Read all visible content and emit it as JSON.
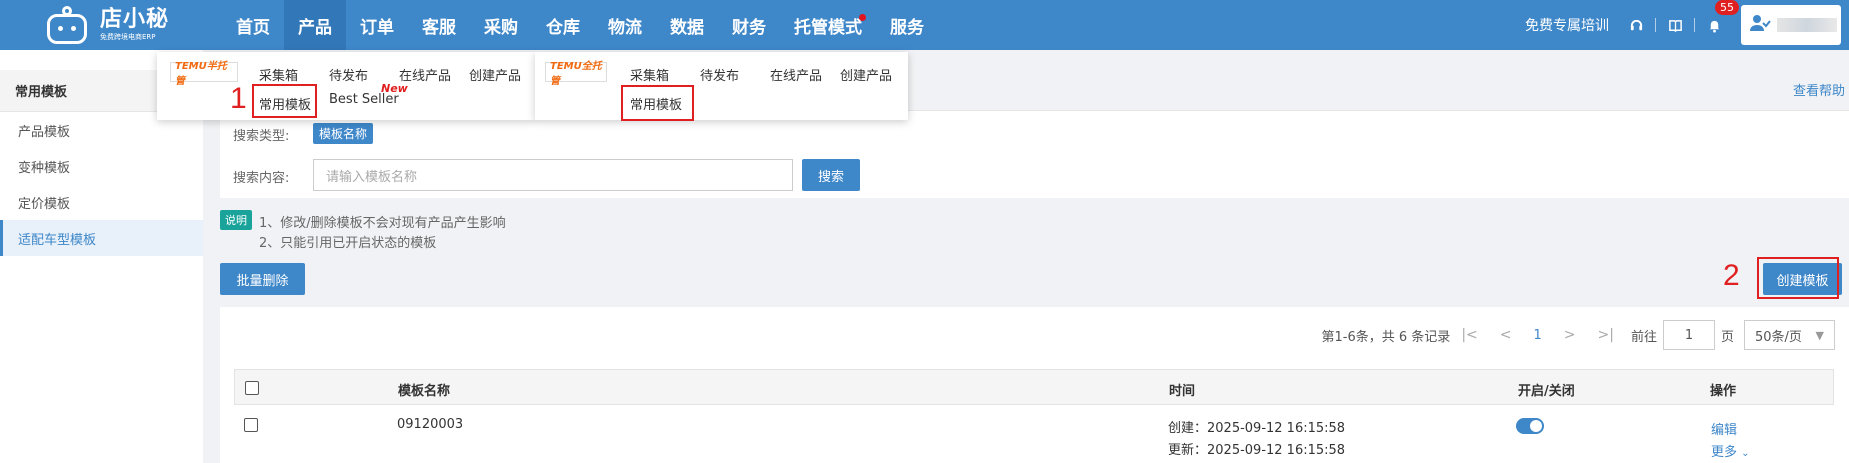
{
  "header": {
    "logo_title": "店小秘",
    "logo_sub": "免费跨境电商ERP",
    "nav": [
      "首页",
      "产品",
      "订单",
      "客服",
      "采购",
      "仓库",
      "物流",
      "数据",
      "财务",
      "托管模式",
      "服务"
    ],
    "training": "免费专属培训",
    "notification_count": "55"
  },
  "dropdown_half": {
    "logo": "TEMU半托管",
    "items": [
      "采集箱",
      "待发布",
      "在线产品",
      "创建产品"
    ],
    "row2": [
      "常用模板",
      "Best Seller"
    ],
    "new_label": "New",
    "marker": "1"
  },
  "dropdown_full": {
    "logo": "TEMU全托管",
    "items": [
      "采集箱",
      "待发布",
      "在线产品",
      "创建产品"
    ],
    "row2": [
      "常用模板"
    ]
  },
  "sidebar": {
    "title": "常用模板",
    "items": [
      "产品模板",
      "变种模板",
      "定价模板",
      "适配车型模板"
    ]
  },
  "help": "查看帮助",
  "search": {
    "type_label": "搜索类型:",
    "type_value": "模板名称",
    "content_label": "搜索内容:",
    "placeholder": "请输入模板名称",
    "button": "搜索"
  },
  "notes": {
    "tag": "说明",
    "line1": "1、修改/删除模板不会对现有产品产生影响",
    "line2": "2、只能引用已开启状态的模板"
  },
  "actions": {
    "batch_delete": "批量删除",
    "create": "创建模板",
    "marker": "2"
  },
  "pager": {
    "summary": "第1-6条，共 6 条记录",
    "current": "1",
    "goto_label": "前往",
    "goto_value": "1",
    "page_unit": "页",
    "page_size": "50条/页"
  },
  "table": {
    "columns": [
      "模板名称",
      "时间",
      "开启/关闭",
      "操作"
    ],
    "rows": [
      {
        "name": "09120003",
        "created": "创建：2025-09-12 16:15:58",
        "updated": "更新：2025-09-12 16:15:58",
        "enabled": true,
        "edit": "编辑",
        "more": "更多"
      }
    ]
  },
  "colors": {
    "primary": "#3e87c9",
    "highlight": "#e02020",
    "note": "#1aa39a",
    "temu": "#f26a10"
  }
}
